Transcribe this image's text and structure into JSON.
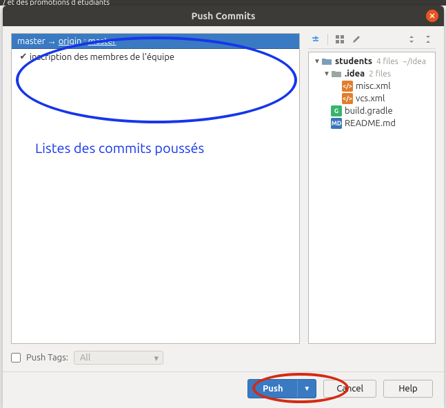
{
  "window_title": "Push Commits",
  "branch": {
    "local": "master",
    "arrow": "→",
    "remote": "origin",
    "sep": ":",
    "remote_branch": "master"
  },
  "commits": [
    {
      "checked": true,
      "message": "inscription des membres de l'équipe"
    }
  ],
  "annotation": {
    "text": "Listes des commits poussés"
  },
  "tree": {
    "root": {
      "name": "students",
      "meta1": "4 files",
      "meta2": "~/Idea"
    },
    "idea": {
      "name": ".idea",
      "meta": "2 files"
    },
    "files": {
      "misc": "misc.xml",
      "vcs": "vcs.xml",
      "gradle": "build.gradle",
      "readme": "README.md"
    }
  },
  "push_tags": {
    "label": "Push Tags:",
    "select": "All"
  },
  "buttons": {
    "push": "Push",
    "cancel": "Cancel",
    "help": "Help"
  },
  "decor": "                / et des promotions d etudiants"
}
